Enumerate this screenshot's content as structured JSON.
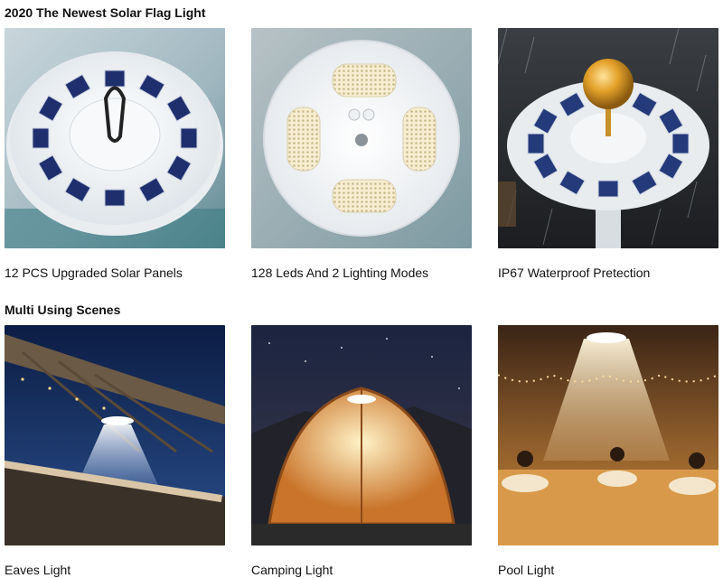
{
  "sections": [
    {
      "title": "2020 The Newest Solar Flag Light",
      "items": [
        {
          "caption": "12 PCS Upgraded Solar Panels",
          "image": "solar-panel-top-view"
        },
        {
          "caption": "128 Leds And 2 Lighting Modes",
          "image": "led-bottom-view"
        },
        {
          "caption": "IP67 Waterproof Pretection",
          "image": "light-in-rain"
        }
      ]
    },
    {
      "title": "Multi Using Scenes",
      "items": [
        {
          "caption": "Eaves Light",
          "image": "eaves-scene"
        },
        {
          "caption": "Camping Light",
          "image": "camping-scene"
        },
        {
          "caption": "Pool Light",
          "image": "pool-scene"
        }
      ]
    }
  ],
  "colors": {
    "text": "#111111",
    "panel_blue": "#1f2f6e",
    "light_body": "#f4f6f8",
    "warm_light": "#f6c970",
    "night_sky": "#0d1b3a"
  }
}
